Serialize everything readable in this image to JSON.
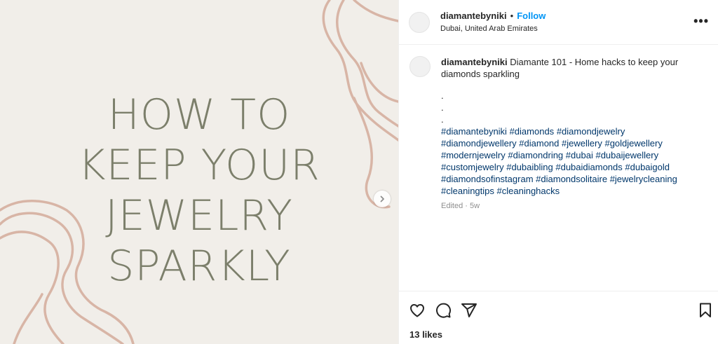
{
  "media": {
    "title_lines": [
      "HOW TO",
      "KEEP YOUR",
      "JEWELRY",
      "SPARKLY"
    ],
    "text_color": "#7c7f6b",
    "background": "#f1eee9",
    "decoration_color": "#d8b5a6",
    "next_icon": "chevron-right-icon"
  },
  "header": {
    "username": "diamantebyniki",
    "separator": "•",
    "follow_label": "Follow",
    "location": "Dubai, United Arab Emirates",
    "more_label": "•••"
  },
  "caption": {
    "username": "diamantebyniki",
    "text": "Diamante 101 - Home hacks to keep your diamonds sparkling",
    "dots": [
      ".",
      ".",
      "."
    ],
    "hashtags": [
      "#diamantebyniki",
      "#diamonds",
      "#diamondjewelry",
      "#diamondjewellery",
      "#diamond",
      "#jewellery",
      "#goldjewellery",
      "#modernjewelry",
      "#diamondring",
      "#dubai",
      "#dubaijewellery",
      "#customjewelry",
      "#dubaibling",
      "#dubaidiamonds",
      "#dubaigold",
      "#diamondsofinstagram",
      "#diamondsolitaire",
      "#jewelrycleaning",
      "#cleaningtips",
      "#cleaninghacks"
    ],
    "edited": "Edited · 5w"
  },
  "actions": {
    "like_icon": "heart-icon",
    "comment_icon": "comment-icon",
    "share_icon": "share-icon",
    "save_icon": "bookmark-icon",
    "likes": "13 likes"
  },
  "colors": {
    "link": "#0095f6",
    "hashtag": "#00376b",
    "muted": "#8e8e8e"
  }
}
